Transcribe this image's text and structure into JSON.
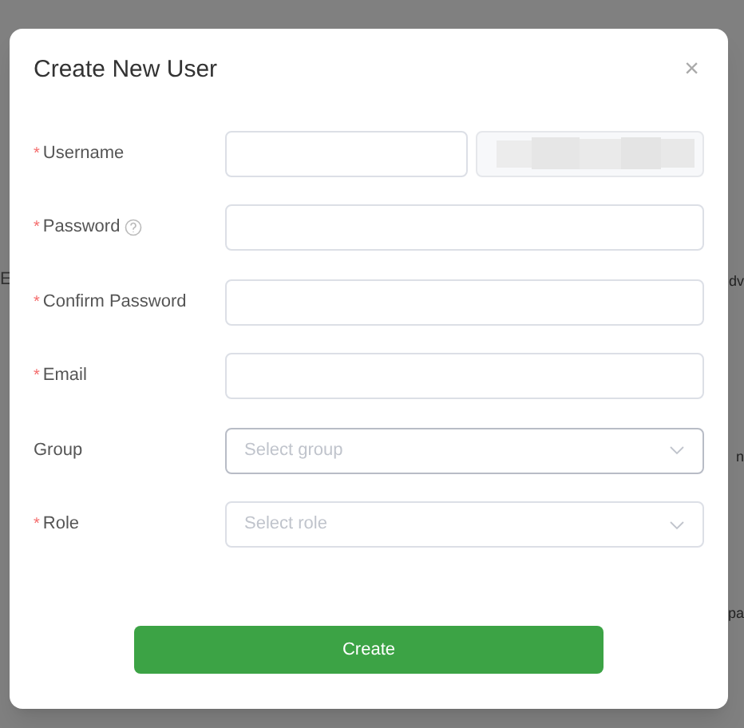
{
  "background": {
    "fragments": [
      {
        "kind": "left",
        "text": "E"
      },
      {
        "kind": "right",
        "text": "dv"
      },
      {
        "kind": "right",
        "text": "n"
      },
      {
        "kind": "right",
        "text": "pa"
      }
    ]
  },
  "dialog": {
    "title": "Create New User",
    "close": "×",
    "fields": [
      {
        "kind": "text",
        "required_mark": "*",
        "label": "Username",
        "captcha": true
      },
      {
        "kind": "text",
        "required_mark": "*",
        "label": "Password",
        "help": true
      },
      {
        "kind": "text",
        "required_mark": "*",
        "label": "Confirm Password"
      },
      {
        "kind": "text",
        "required_mark": "*",
        "label": "Email"
      },
      {
        "kind": "select",
        "label": "Group",
        "placeholder": "Select group",
        "focused": true
      },
      {
        "kind": "select",
        "required_mark": "*",
        "label": "Role",
        "placeholder": "Select role",
        "focused": false
      }
    ],
    "submit": "Create"
  }
}
